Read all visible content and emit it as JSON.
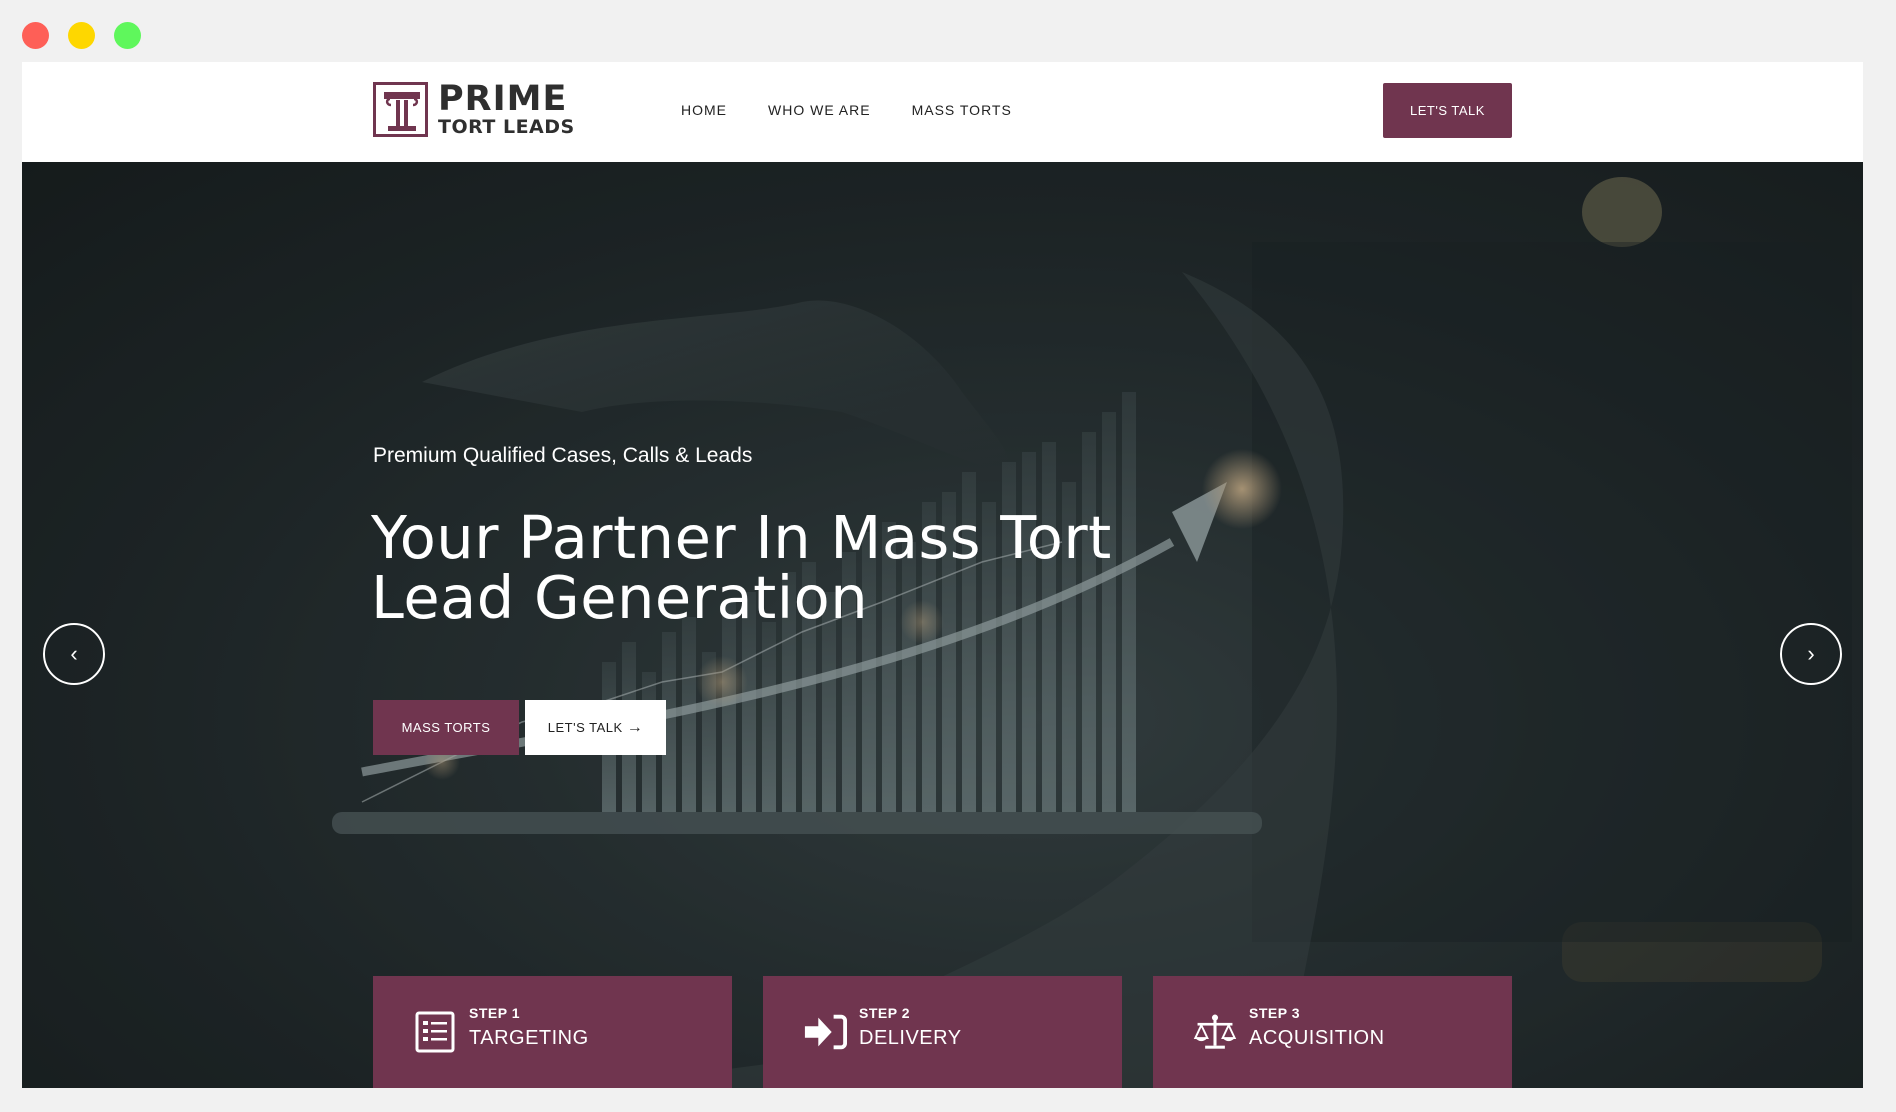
{
  "window": {
    "controls": [
      "close",
      "minimize",
      "maximize"
    ]
  },
  "colors": {
    "brand": "#70354f",
    "hero_bg": "#232b2d",
    "text_light": "#ffffff"
  },
  "logo": {
    "prime": "PRIME",
    "sub": "TORT LEADS"
  },
  "nav": {
    "items": [
      "HOME",
      "WHO WE ARE",
      "MASS TORTS"
    ]
  },
  "header": {
    "cta_label": "LET'S TALK"
  },
  "hero": {
    "eyebrow": "Premium Qualified Cases, Calls & Leads",
    "title_line1": "Your Partner In Mass Tort",
    "title_line2": "Lead Generation",
    "primary_button": "MASS TORTS",
    "secondary_button": "LET'S TALK",
    "prev_icon": "chevron-left-icon",
    "next_icon": "chevron-right-icon"
  },
  "steps": [
    {
      "num": "STEP 1",
      "label": "TARGETING",
      "icon": "list-document-icon"
    },
    {
      "num": "STEP 2",
      "label": "DELIVERY",
      "icon": "sign-in-arrow-icon"
    },
    {
      "num": "STEP 3",
      "label": "ACQUISITION",
      "icon": "balance-scale-icon"
    }
  ]
}
